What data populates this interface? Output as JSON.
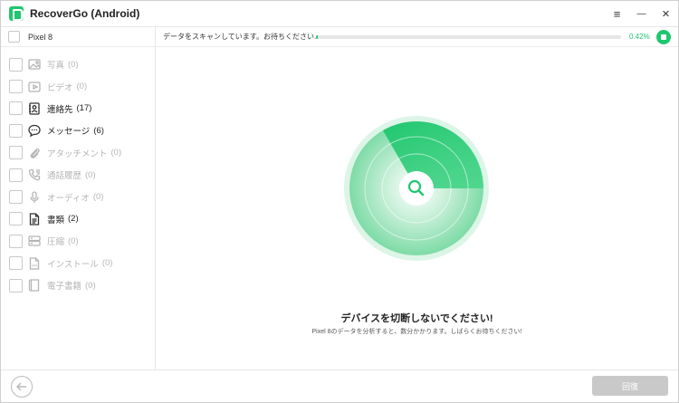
{
  "app": {
    "title": "RecoverGo (Android)"
  },
  "window_controls": [
    {
      "name": "menu-icon",
      "glyph": "≡"
    },
    {
      "name": "minimize-icon",
      "glyph": "—"
    },
    {
      "name": "close-icon",
      "glyph": "✕"
    }
  ],
  "sidebar": {
    "device": "Pixel 8",
    "categories": [
      {
        "label": "写真",
        "count": "(0)",
        "icon": "photo-icon",
        "enabled": false
      },
      {
        "label": "ビデオ",
        "count": "(0)",
        "icon": "video-icon",
        "enabled": false
      },
      {
        "label": "連絡先",
        "count": "(17)",
        "icon": "contacts-icon",
        "enabled": true
      },
      {
        "label": "メッセージ",
        "count": "(6)",
        "icon": "message-icon",
        "enabled": true
      },
      {
        "label": "アタッチメント",
        "count": "(0)",
        "icon": "attachment-icon",
        "enabled": false
      },
      {
        "label": "通話履歴",
        "count": "(0)",
        "icon": "call-log-icon",
        "enabled": false
      },
      {
        "label": "オーディオ",
        "count": "(0)",
        "icon": "microphone-icon",
        "enabled": false
      },
      {
        "label": "書類",
        "count": "(2)",
        "icon": "document-icon",
        "enabled": true
      },
      {
        "label": "圧縮",
        "count": "(0)",
        "icon": "archive-icon",
        "enabled": false
      },
      {
        "label": "インストール",
        "count": "(0)",
        "icon": "apk-icon",
        "enabled": false
      },
      {
        "label": "電子書籍",
        "count": "(0)",
        "icon": "ebook-icon",
        "enabled": false
      }
    ]
  },
  "scan": {
    "status": "データをスキャンしています。お待ちください...",
    "percent_label": "0.42%",
    "progress_fraction": 0.0042
  },
  "notice": {
    "title": "デバイスを切断しないでください!",
    "subtitle": "Pixel 8のデータを分析すると、数分かかります。しばらくお待ちください!"
  },
  "footer": {
    "recover_label": "回復"
  },
  "colors": {
    "accent": "#1fc66f",
    "disabled_button": "#c9c9c9"
  }
}
